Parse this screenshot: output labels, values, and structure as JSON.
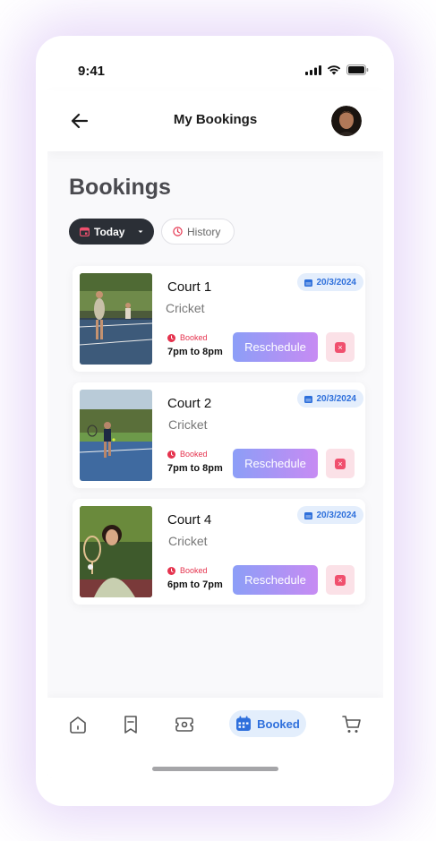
{
  "status_bar": {
    "time": "9:41"
  },
  "header": {
    "title": "My Bookings"
  },
  "page": {
    "title": "Bookings"
  },
  "filters": {
    "today_label": "Today",
    "history_label": "History"
  },
  "bookings": [
    {
      "court": "Court 1",
      "sport": "Cricket",
      "date": "20/3/2024",
      "status": "Booked",
      "time": "7pm to 8pm",
      "reschedule": "Reschedule"
    },
    {
      "court": "Court 2",
      "sport": "Cricket",
      "date": "20/3/2024",
      "status": "Booked",
      "time": "7pm to 8pm",
      "reschedule": "Reschedule"
    },
    {
      "court": "Court 4",
      "sport": "Cricket",
      "date": "20/3/2024",
      "status": "Booked",
      "time": "6pm to 7pm",
      "reschedule": "Reschedule"
    }
  ],
  "bottom_nav": {
    "active_label": "Booked",
    "icons": [
      "home-icon",
      "bookmark-icon",
      "ticket-icon",
      "calendar-icon",
      "cart-icon"
    ]
  },
  "colors": {
    "accent": "#2e6fdc",
    "danger": "#e5334e",
    "dark_chip": "#2b2f36",
    "gradient_start": "#8c9ef7",
    "gradient_end": "#c78bf3"
  }
}
